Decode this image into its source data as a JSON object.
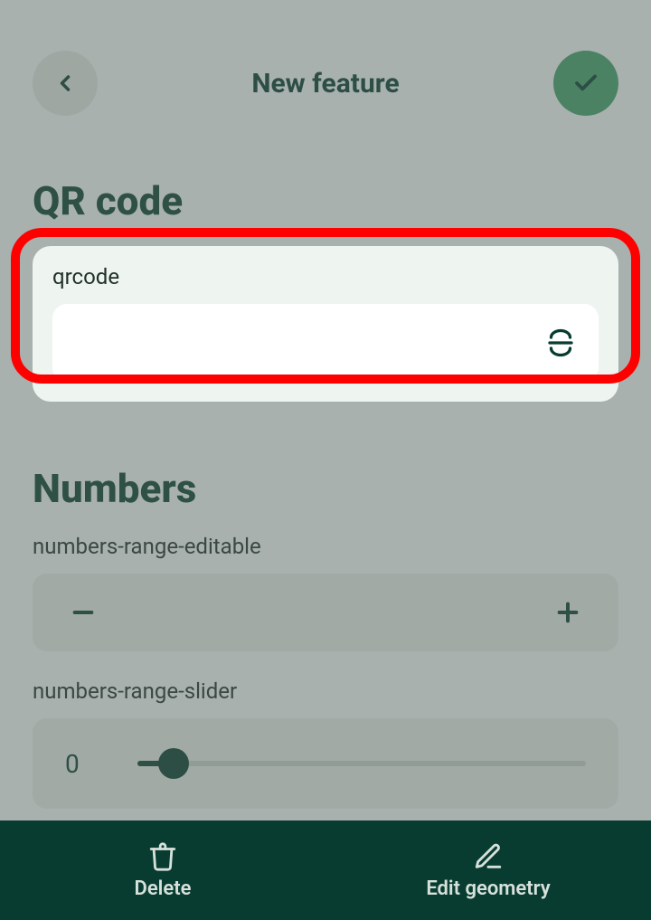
{
  "header": {
    "title": "New feature"
  },
  "sections": {
    "qr": {
      "title": "QR code",
      "field_label": "qrcode",
      "input_value": ""
    },
    "numbers": {
      "title": "Numbers",
      "range_editable_label": "numbers-range-editable",
      "range_slider_label": "numbers-range-slider",
      "slider_value": "0"
    }
  },
  "bottom": {
    "delete": "Delete",
    "edit_geometry": "Edit geometry"
  }
}
